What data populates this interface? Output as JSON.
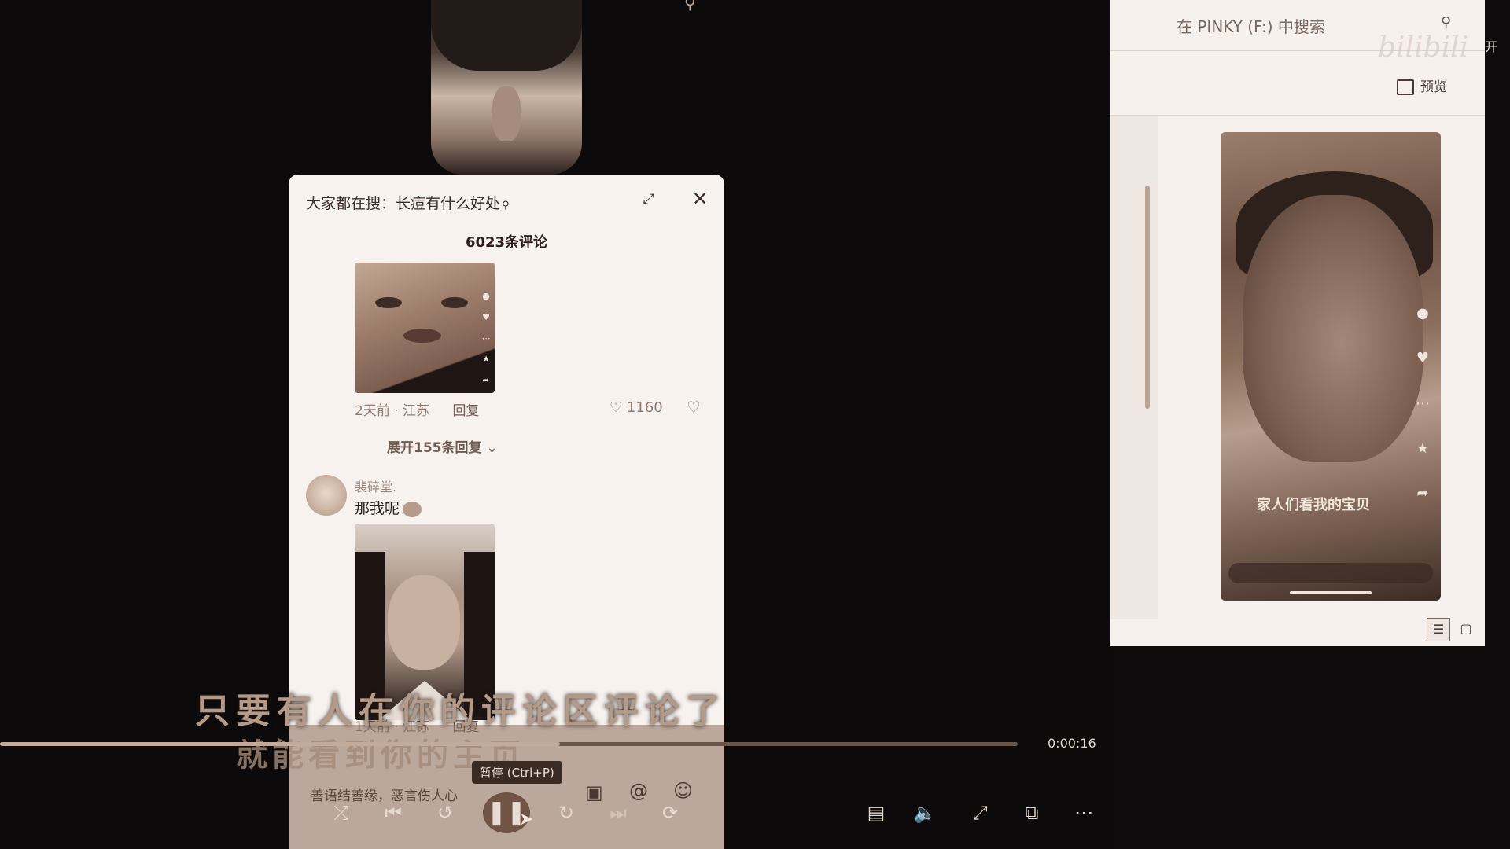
{
  "comment_panel": {
    "title": "大家都在搜：长痘有什么好处",
    "comment_count": "6023条评论",
    "comment_1": {
      "time_location": "2天前 · 江苏",
      "reply_label": "回复",
      "likes": "1160"
    },
    "expand_replies": "展开155条回复",
    "comment_2": {
      "username": "裴碎堂.",
      "text": "那我呢",
      "time_location": "1天前 · 江苏",
      "reply_label": "回复"
    },
    "input_hint": "善语结善缘，恶言伤人心"
  },
  "player": {
    "subtitle_line1": "只要有人在你的评论区评论了",
    "subtitle_line2": "就能看到你的主页",
    "time": "0:00:16",
    "progress": 0.55,
    "pause_tooltip": "暂停 (Ctrl+P)"
  },
  "explorer": {
    "search_label": "在 PINKY (F:) 中搜索",
    "open_label": "开",
    "watermark": "bilibili",
    "preview_label": "预览",
    "phone_caption": "家人们看我的宝贝"
  },
  "icons": {
    "shuffle": "shuffle-icon",
    "previous": "previous-icon",
    "rewind": "rewind-10-icon",
    "pause": "pause-icon",
    "forward": "forward-30-icon",
    "next": "next-icon",
    "repeat": "repeat-off-icon",
    "caption": "caption-icon",
    "volume": "volume-icon",
    "fullscreen": "fullscreen-icon",
    "pip": "picture-in-picture-icon",
    "more": "more-icon"
  },
  "colors": {
    "panel_bg": "#f7f2ee",
    "page_bg": "#0c0a0b",
    "sepia_accent": "#8a6a5a"
  }
}
